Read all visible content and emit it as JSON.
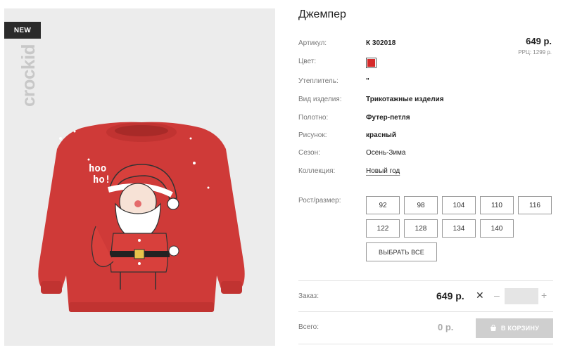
{
  "product": {
    "title": "Джемпер",
    "badge": "NEW",
    "brand": "crockid"
  },
  "attributes": [
    {
      "label": "Артикул:",
      "value": "К 302018"
    },
    {
      "label": "Цвет:",
      "value": "",
      "color": "#d52a2a"
    },
    {
      "label": "Утеплитель:",
      "value": "\""
    },
    {
      "label": "Вид изделия:",
      "value": "Трикотажные изделия"
    },
    {
      "label": "Полотно:",
      "value": "Футер-петля"
    },
    {
      "label": "Рисунок:",
      "value": "красный"
    },
    {
      "label": "Сезон:",
      "value": "Осень-Зима"
    },
    {
      "label": "Коллекция:",
      "value": "Новый год"
    }
  ],
  "price": {
    "current": "649 р.",
    "rrp": "РРЦ: 1299 р."
  },
  "sizes": {
    "label": "Рост/размер:",
    "options": [
      "92",
      "98",
      "104",
      "110",
      "116",
      "122",
      "128",
      "134",
      "140"
    ],
    "select_all": "ВЫБРАТЬ ВСЕ"
  },
  "order": {
    "label": "Заказ:",
    "price": "649 р.",
    "times": "✕",
    "minus": "–",
    "plus": "+",
    "quantity": ""
  },
  "total": {
    "label": "Всего:",
    "value": "0 р.",
    "cart_button": "В КОРЗИНУ"
  },
  "sweater_text": {
    "line1": "hoo",
    "line2": "ho!"
  }
}
